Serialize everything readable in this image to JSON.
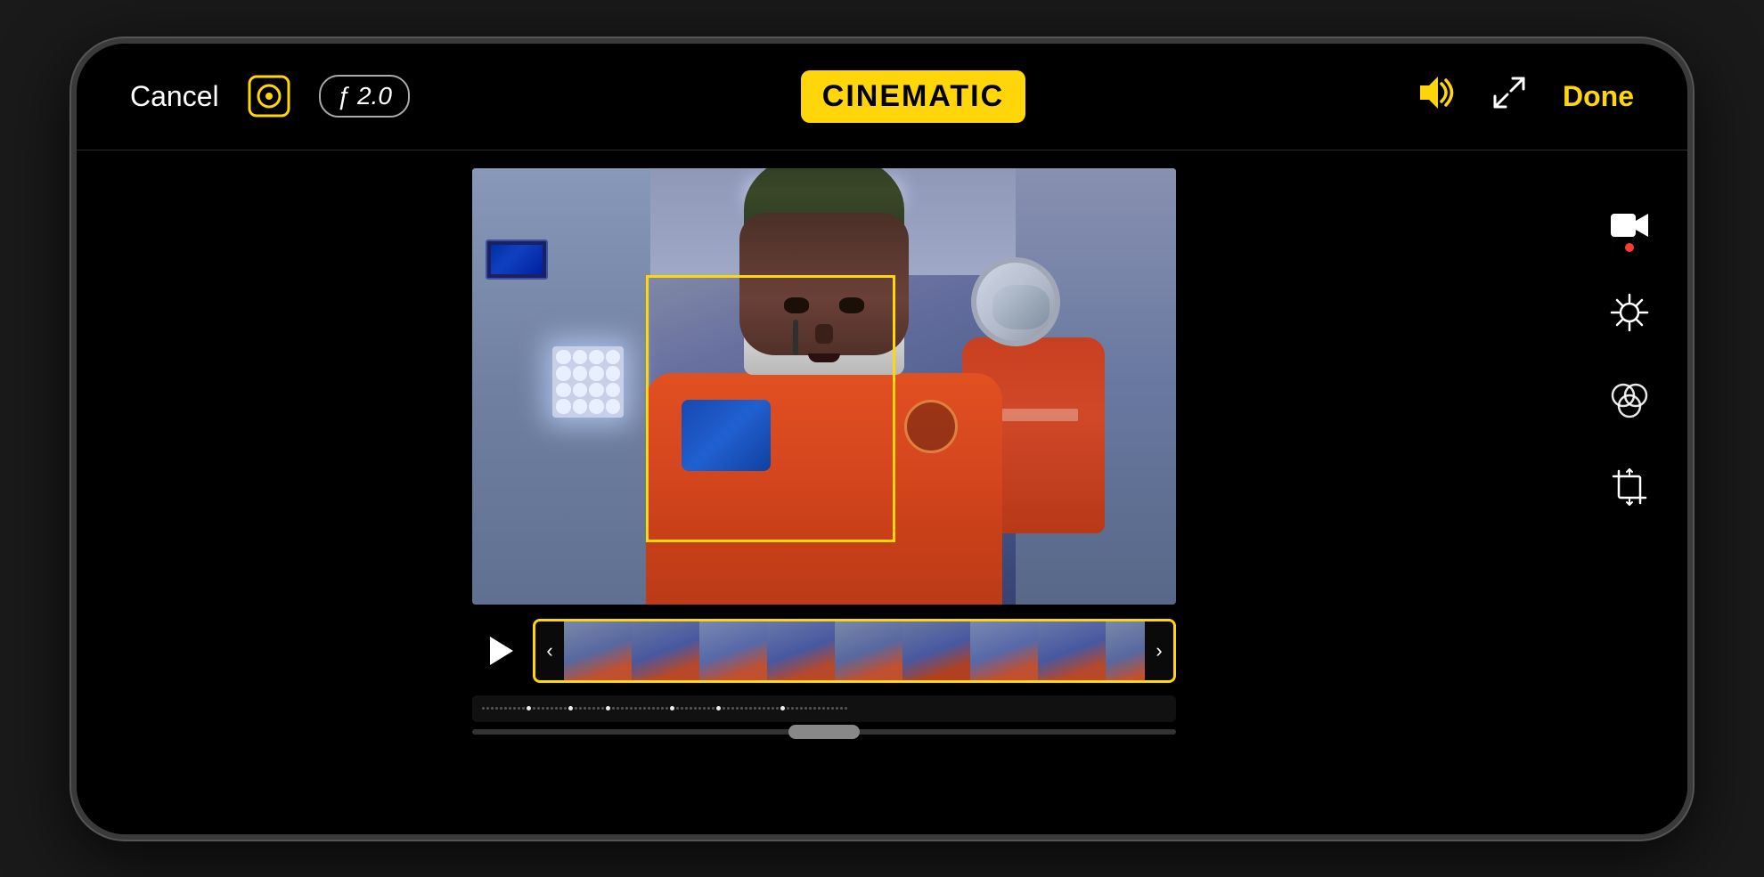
{
  "header": {
    "cancel_label": "Cancel",
    "aperture_label": "ƒ 2.0",
    "cinematic_label": "CINEMATIC",
    "done_label": "Done"
  },
  "controls": {
    "play_label": "Play",
    "filmstrip_arrow_left": "‹",
    "filmstrip_arrow_right": "›"
  },
  "sidebar": {
    "video_icon": "video-camera",
    "adjust_icon": "adjust",
    "color_icon": "color-channels",
    "crop_icon": "crop-rotate"
  },
  "filmstrip": {
    "frames": [
      0,
      1,
      2,
      3,
      4,
      5,
      6,
      7,
      8
    ]
  }
}
